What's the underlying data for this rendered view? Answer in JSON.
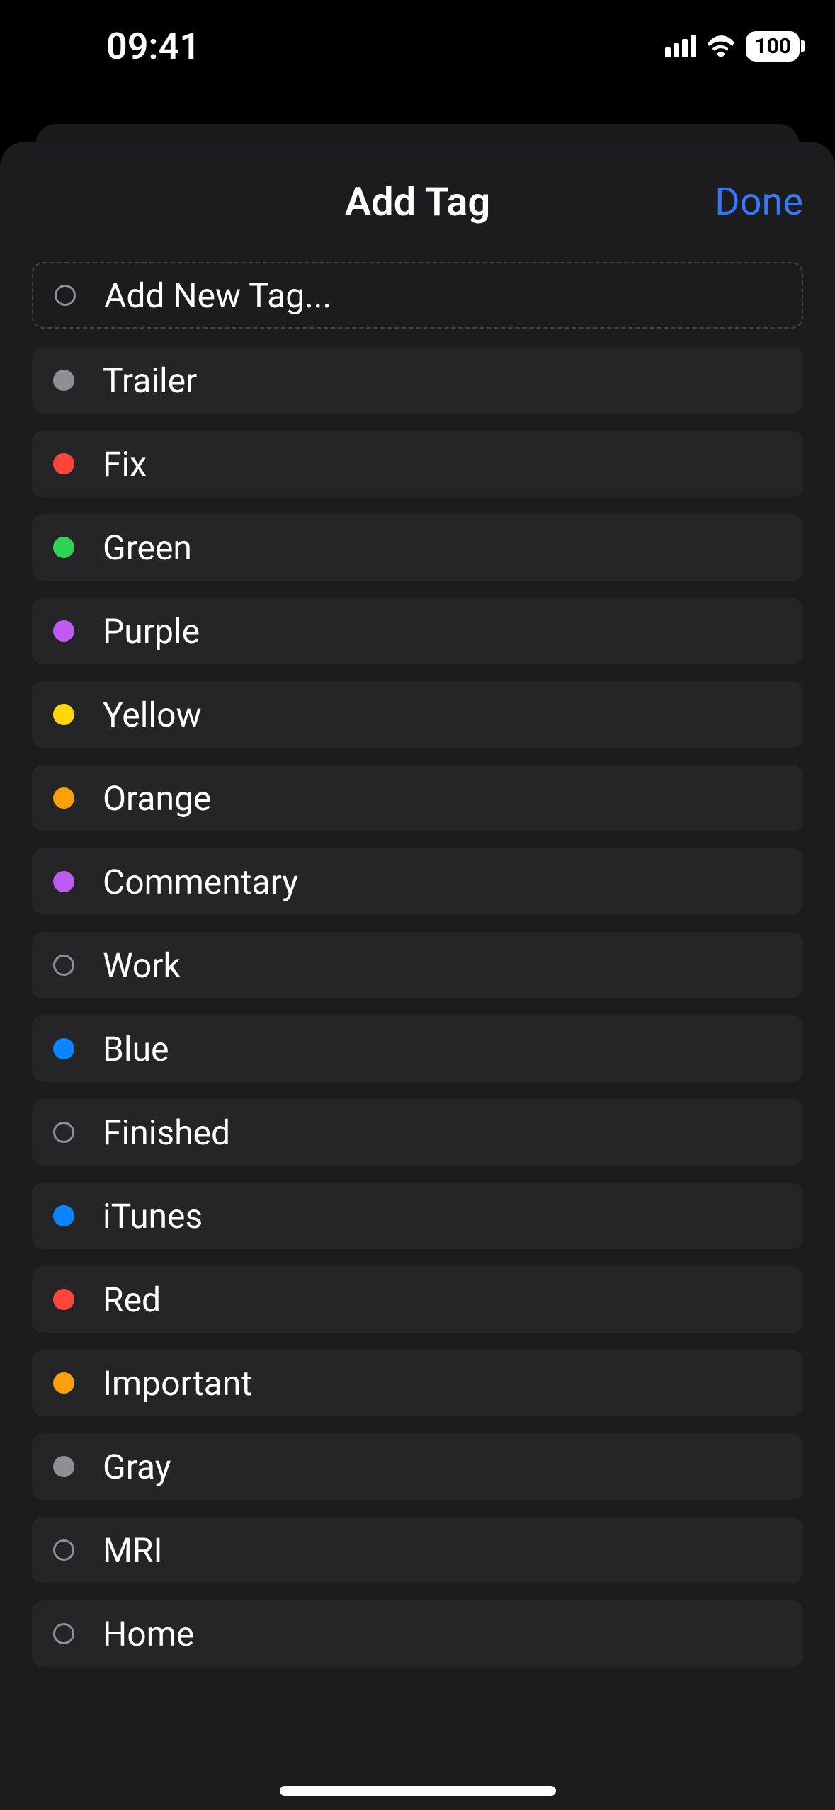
{
  "statusBar": {
    "time": "09:41",
    "battery": "100"
  },
  "sheet": {
    "title": "Add Tag",
    "doneLabel": "Done",
    "addNewLabel": "Add New Tag..."
  },
  "tags": [
    {
      "label": "Trailer",
      "color": "#8e8e93",
      "hasColor": true
    },
    {
      "label": "Fix",
      "color": "#ff453a",
      "hasColor": true
    },
    {
      "label": "Green",
      "color": "#30d158",
      "hasColor": true
    },
    {
      "label": "Purple",
      "color": "#bf5af2",
      "hasColor": true
    },
    {
      "label": "Yellow",
      "color": "#ffd60a",
      "hasColor": true
    },
    {
      "label": "Orange",
      "color": "#ff9f0a",
      "hasColor": true
    },
    {
      "label": "Commentary",
      "color": "#bf5af2",
      "hasColor": true
    },
    {
      "label": "Work",
      "color": "",
      "hasColor": false
    },
    {
      "label": "Blue",
      "color": "#0a84ff",
      "hasColor": true
    },
    {
      "label": "Finished",
      "color": "",
      "hasColor": false
    },
    {
      "label": "iTunes",
      "color": "#0a84ff",
      "hasColor": true
    },
    {
      "label": "Red",
      "color": "#ff453a",
      "hasColor": true
    },
    {
      "label": "Important",
      "color": "#ff9f0a",
      "hasColor": true
    },
    {
      "label": "Gray",
      "color": "#8e8e93",
      "hasColor": true
    },
    {
      "label": "MRI",
      "color": "",
      "hasColor": false
    },
    {
      "label": "Home",
      "color": "",
      "hasColor": false
    }
  ]
}
